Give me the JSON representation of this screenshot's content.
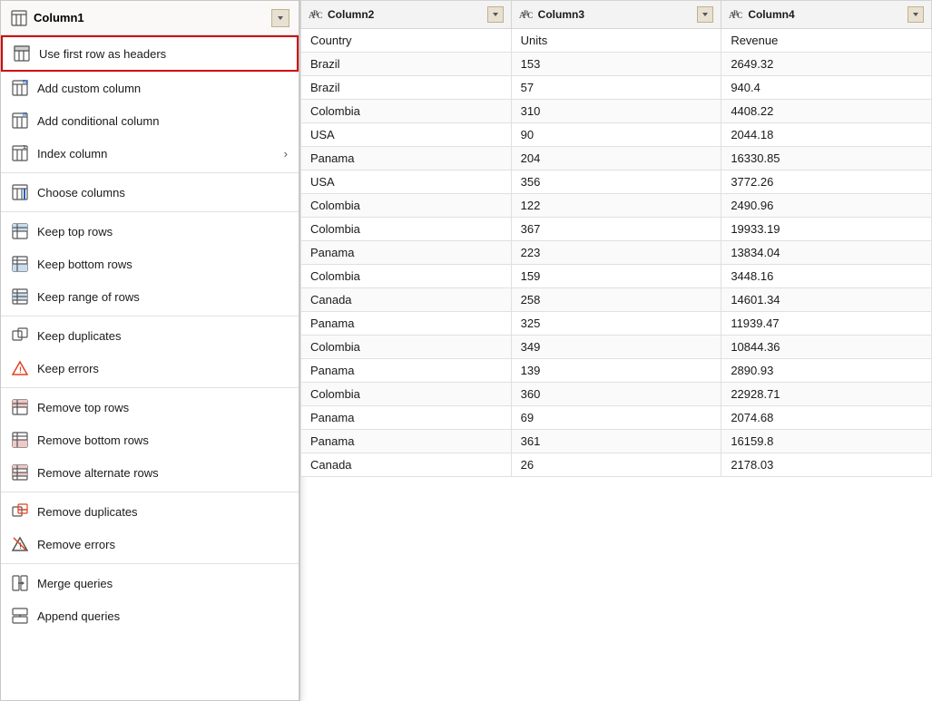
{
  "menu": {
    "header": {
      "col_label": "Column1",
      "dropdown_arrow": "▼"
    },
    "items": [
      {
        "id": "use-first-row-as-headers",
        "label": "Use first row as headers",
        "icon": "table-header-icon",
        "highlighted": true,
        "has_arrow": false
      },
      {
        "id": "add-custom-column",
        "label": "Add custom column",
        "icon": "custom-col-icon",
        "highlighted": false,
        "has_arrow": false
      },
      {
        "id": "add-conditional-column",
        "label": "Add conditional column",
        "icon": "conditional-col-icon",
        "highlighted": false,
        "has_arrow": false
      },
      {
        "id": "index-column",
        "label": "Index column",
        "icon": "index-col-icon",
        "highlighted": false,
        "has_arrow": true
      },
      {
        "id": "divider1",
        "label": "",
        "icon": "",
        "highlighted": false,
        "has_arrow": false,
        "divider": true
      },
      {
        "id": "choose-columns",
        "label": "Choose columns",
        "icon": "choose-cols-icon",
        "highlighted": false,
        "has_arrow": false
      },
      {
        "id": "divider2",
        "label": "",
        "icon": "",
        "highlighted": false,
        "has_arrow": false,
        "divider": true
      },
      {
        "id": "keep-top-rows",
        "label": "Keep top rows",
        "icon": "keep-top-icon",
        "highlighted": false,
        "has_arrow": false
      },
      {
        "id": "keep-bottom-rows",
        "label": "Keep bottom rows",
        "icon": "keep-bottom-icon",
        "highlighted": false,
        "has_arrow": false
      },
      {
        "id": "keep-range-of-rows",
        "label": "Keep range of rows",
        "icon": "keep-range-icon",
        "highlighted": false,
        "has_arrow": false
      },
      {
        "id": "divider3",
        "label": "",
        "icon": "",
        "highlighted": false,
        "has_arrow": false,
        "divider": true
      },
      {
        "id": "keep-duplicates",
        "label": "Keep duplicates",
        "icon": "keep-dup-icon",
        "highlighted": false,
        "has_arrow": false
      },
      {
        "id": "keep-errors",
        "label": "Keep errors",
        "icon": "keep-err-icon",
        "highlighted": false,
        "has_arrow": false
      },
      {
        "id": "divider4",
        "label": "",
        "icon": "",
        "highlighted": false,
        "has_arrow": false,
        "divider": true
      },
      {
        "id": "remove-top-rows",
        "label": "Remove top rows",
        "icon": "remove-top-icon",
        "highlighted": false,
        "has_arrow": false
      },
      {
        "id": "remove-bottom-rows",
        "label": "Remove bottom rows",
        "icon": "remove-bottom-icon",
        "highlighted": false,
        "has_arrow": false
      },
      {
        "id": "remove-alternate-rows",
        "label": "Remove alternate rows",
        "icon": "remove-alt-icon",
        "highlighted": false,
        "has_arrow": false
      },
      {
        "id": "divider5",
        "label": "",
        "icon": "",
        "highlighted": false,
        "has_arrow": false,
        "divider": true
      },
      {
        "id": "remove-duplicates",
        "label": "Remove duplicates",
        "icon": "remove-dup-icon",
        "highlighted": false,
        "has_arrow": false
      },
      {
        "id": "remove-errors",
        "label": "Remove errors",
        "icon": "remove-err-icon",
        "highlighted": false,
        "has_arrow": false
      },
      {
        "id": "divider6",
        "label": "",
        "icon": "",
        "highlighted": false,
        "has_arrow": false,
        "divider": true
      },
      {
        "id": "merge-queries",
        "label": "Merge queries",
        "icon": "merge-icon",
        "highlighted": false,
        "has_arrow": false
      },
      {
        "id": "append-queries",
        "label": "Append queries",
        "icon": "append-icon",
        "highlighted": false,
        "has_arrow": false
      }
    ]
  },
  "table": {
    "columns": [
      {
        "id": "col2",
        "label": "Column2",
        "type": "ABC"
      },
      {
        "id": "col3",
        "label": "Column3",
        "type": "ABC"
      },
      {
        "id": "col4",
        "label": "Column4",
        "type": "ABC"
      }
    ],
    "rows": [
      {
        "col2": "Country",
        "col3": "Units",
        "col4": "Revenue"
      },
      {
        "col2": "Brazil",
        "col3": "153",
        "col4": "2649.32"
      },
      {
        "col2": "Brazil",
        "col3": "57",
        "col4": "940.4"
      },
      {
        "col2": "Colombia",
        "col3": "310",
        "col4": "4408.22"
      },
      {
        "col2": "USA",
        "col3": "90",
        "col4": "2044.18"
      },
      {
        "col2": "Panama",
        "col3": "204",
        "col4": "16330.85"
      },
      {
        "col2": "USA",
        "col3": "356",
        "col4": "3772.26"
      },
      {
        "col2": "Colombia",
        "col3": "122",
        "col4": "2490.96"
      },
      {
        "col2": "Colombia",
        "col3": "367",
        "col4": "19933.19"
      },
      {
        "col2": "Panama",
        "col3": "223",
        "col4": "13834.04"
      },
      {
        "col2": "Colombia",
        "col3": "159",
        "col4": "3448.16"
      },
      {
        "col2": "Canada",
        "col3": "258",
        "col4": "14601.34"
      },
      {
        "col2": "Panama",
        "col3": "325",
        "col4": "11939.47"
      },
      {
        "col2": "Colombia",
        "col3": "349",
        "col4": "10844.36"
      },
      {
        "col2": "Panama",
        "col3": "139",
        "col4": "2890.93"
      },
      {
        "col2": "Colombia",
        "col3": "360",
        "col4": "22928.71"
      },
      {
        "col2": "Panama",
        "col3": "69",
        "col4": "2074.68"
      },
      {
        "col2": "Panama",
        "col3": "361",
        "col4": "16159.8"
      },
      {
        "col2": "Canada",
        "col3": "26",
        "col4": "2178.03"
      }
    ]
  }
}
